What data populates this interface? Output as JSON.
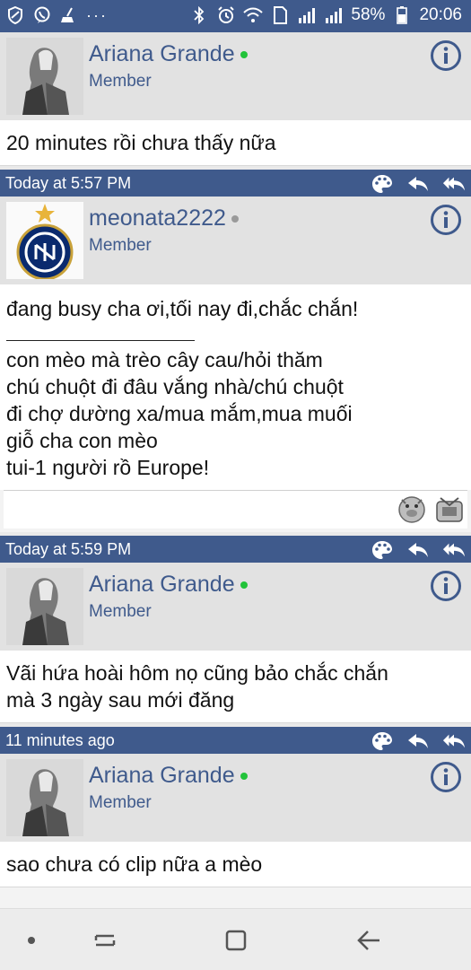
{
  "status_bar": {
    "battery_percent": "58%",
    "time": "20:06",
    "more": "···"
  },
  "posts": [
    {
      "author": "Ariana Grande",
      "role": "Member",
      "online": true,
      "lines": [
        "20 minutes rồi chưa thấy nữa"
      ]
    },
    {
      "time": "Today at 5:57 PM",
      "author": "meonata2222",
      "role": "Member",
      "online": false,
      "lines_top": [
        "đang busy cha ơi,tối nay đi,chắc chắn!"
      ],
      "lines_bottom": [
        "con mèo mà trèo cây cau/hỏi thăm",
        "chú chuột đi đâu vắng nhà/chú chuột",
        "đi chợ dường xa/mua mắm,mua muối",
        "giỗ cha con mèo",
        "tui-1 người rồ Europe!"
      ]
    },
    {
      "time": "Today at 5:59 PM",
      "author": "Ariana Grande",
      "role": "Member",
      "online": true,
      "lines": [
        "Vãi hứa hoài hôm nọ cũng bảo chắc chắn",
        "mà 3 ngày sau mới đăng"
      ]
    },
    {
      "time": "11 minutes ago",
      "author": "Ariana Grande",
      "role": "Member",
      "online": true,
      "lines": [
        "sao chưa có clip nữa a mèo"
      ]
    }
  ],
  "colors": {
    "header_bg": "#3f5a8c",
    "online": "#22c33a",
    "offline": "#9a9a9a"
  },
  "icons": {
    "palette": "palette-icon",
    "reply": "reply-icon",
    "reply_all": "reply-all-icon",
    "info": "info-icon"
  }
}
